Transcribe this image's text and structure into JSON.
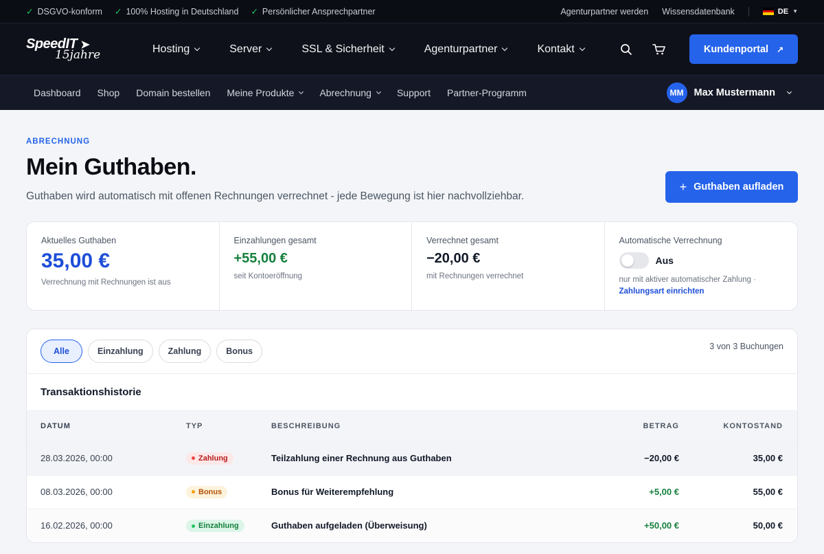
{
  "topbar": {
    "features": [
      "DSGVO-konform",
      "100% Hosting in Deutschland",
      "Persönlicher Ansprechpartner"
    ],
    "links": [
      "Agenturpartner werden",
      "Wissensdatenbank"
    ],
    "language": "DE"
  },
  "brand": {
    "name": "SpeedIT",
    "tagline": "15jahre"
  },
  "mainnav": {
    "items": [
      "Hosting",
      "Server",
      "SSL & Sicherheit",
      "Agenturpartner",
      "Kontakt"
    ],
    "portal_label": "Kundenportal"
  },
  "subnav": {
    "items": [
      "Dashboard",
      "Shop",
      "Domain bestellen",
      "Meine Produkte",
      "Abrechnung",
      "Support",
      "Partner-Programm"
    ],
    "user_initials": "MM",
    "user_name": "Max Mustermann"
  },
  "page": {
    "eyebrow": "ABRECHNUNG",
    "title": "Mein Guthaben.",
    "lede": "Guthaben wird automatisch mit offenen Rechnungen verrechnet - jede Bewegung ist hier nachvollziehbar.",
    "topup_label": "Guthaben aufladen"
  },
  "stats": {
    "balance": {
      "label": "Aktuelles Guthaben",
      "value": "35,00 €",
      "sub": "Verrechnung mit Rechnungen ist aus"
    },
    "deposits": {
      "label": "Einzahlungen gesamt",
      "value": "+55,00 €",
      "sub": "seit Kontoeröffnung"
    },
    "settled": {
      "label": "Verrechnet gesamt",
      "value": "−20,00 €",
      "sub": "mit Rechnungen verrechnet"
    },
    "auto": {
      "label": "Automatische Verrechnung",
      "state": "Aus",
      "note": "nur mit aktiver automatischer Zahlung ·",
      "link": "Zahlungsart einrichten"
    }
  },
  "filters": {
    "chips": [
      "Alle",
      "Einzahlung",
      "Zahlung",
      "Bonus"
    ],
    "active": "Alle",
    "count": "3 von 3 Buchungen"
  },
  "table": {
    "title": "Transaktionshistorie",
    "headers": [
      "DATUM",
      "TYP",
      "BESCHREIBUNG",
      "BETRAG",
      "KONTOSTAND"
    ],
    "rows": [
      {
        "date": "28.03.2026, 00:00",
        "type": "Zahlung",
        "desc": "Teilzahlung einer Rechnung aus Guthaben",
        "amount": "−20,00 €",
        "balance": "35,00 €"
      },
      {
        "date": "08.03.2026, 00:00",
        "type": "Bonus",
        "desc": "Bonus für Weiterempfehlung",
        "amount": "+5,00 €",
        "balance": "55,00 €"
      },
      {
        "date": "16.02.2026, 00:00",
        "type": "Einzahlung",
        "desc": "Guthaben aufgeladen (Überweisung)",
        "amount": "+50,00 €",
        "balance": "50,00 €"
      }
    ]
  },
  "colors": {
    "accent": "#2563eb",
    "positive": "#15803d",
    "dark": "#0f111a"
  }
}
